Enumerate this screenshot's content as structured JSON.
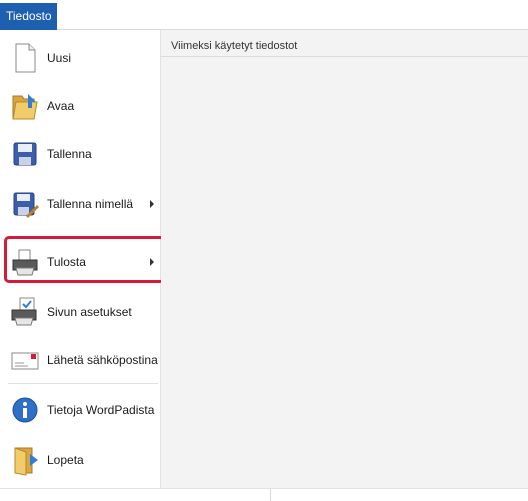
{
  "window": {
    "file_tab": "Tiedosto"
  },
  "menu": {
    "items": [
      {
        "id": "new",
        "label": "Uusi",
        "icon": "new-document-icon",
        "has_submenu": false
      },
      {
        "id": "open",
        "label": "Avaa",
        "icon": "open-folder-icon",
        "has_submenu": false
      },
      {
        "id": "save",
        "label": "Tallenna",
        "icon": "save-disk-icon",
        "has_submenu": false
      },
      {
        "id": "save-as",
        "label": "Tallenna nimellä",
        "icon": "save-as-icon",
        "has_submenu": true
      },
      {
        "id": "print",
        "label": "Tulosta",
        "icon": "printer-icon",
        "has_submenu": true,
        "highlighted": true
      },
      {
        "id": "page-setup",
        "label": "Sivun asetukset",
        "icon": "page-setup-icon",
        "has_submenu": false
      },
      {
        "id": "send-email",
        "label": "Lähetä sähköpostina",
        "icon": "email-icon",
        "has_submenu": false
      },
      {
        "id": "about",
        "label": "Tietoja WordPadista",
        "icon": "info-icon",
        "has_submenu": false
      },
      {
        "id": "exit",
        "label": "Lopeta",
        "icon": "exit-icon",
        "has_submenu": false
      }
    ]
  },
  "recent_panel": {
    "title": "Viimeksi käytetyt tiedostot"
  },
  "colors": {
    "file_tab_bg": "#1f5fb0",
    "highlight_border": "#d61a3c",
    "recent_bg": "#f3f3f3"
  }
}
